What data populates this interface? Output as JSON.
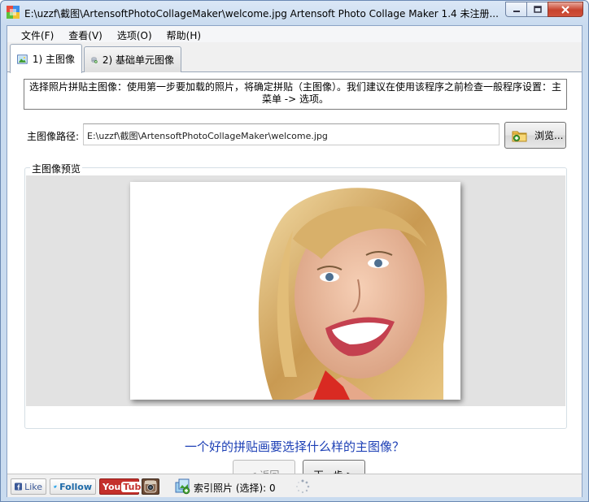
{
  "window": {
    "title": "E:\\uzzf\\截图\\ArtensoftPhotoCollageMaker\\welcome.jpg Artensoft Photo Collage Maker 1.4 未注册..."
  },
  "menu": {
    "items": [
      "文件(F)",
      "查看(V)",
      "选项(O)",
      "帮助(H)"
    ]
  },
  "tabs": [
    {
      "label": "1) 主图像",
      "icon": "image-icon",
      "active": true
    },
    {
      "label": "2) 基础单元图像",
      "icon": "database-add-icon",
      "active": false
    }
  ],
  "main": {
    "description": "选择照片拼贴主图像：使用第一步要加载的照片，将确定拼贴（主图像）。我们建议在使用该程序之前检查一般程序设置：主菜单 -> 选项。",
    "path_label": "主图像路径:",
    "path_value": "E:\\uzzf\\截图\\ArtensoftPhotoCollageMaker\\welcome.jpg",
    "browse_label": "浏览...",
    "preview_legend": "主图像预览",
    "question": "一个好的拼贴画要选择什么样的主图像？",
    "back_label": "< 返回",
    "next_label": "下一步 >"
  },
  "statusbar": {
    "like_label": "Like",
    "follow_label": "Follow",
    "youtube_you": "You",
    "youtube_tube": "Tube",
    "index_label": "索引照片 (选择): 0"
  },
  "colors": {
    "accent_link": "#1c3fb5",
    "facebook": "#3b5998",
    "youtube": "#c4302b"
  }
}
